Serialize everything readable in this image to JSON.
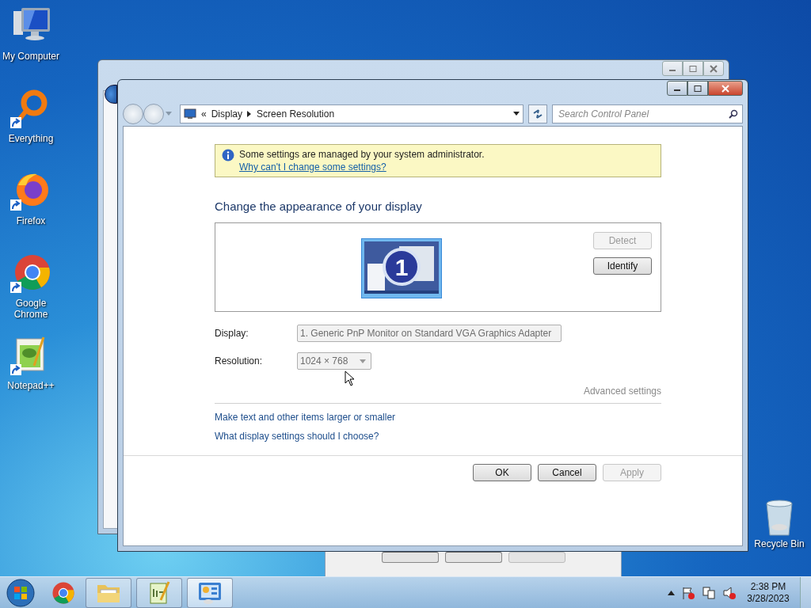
{
  "desktop_icons": [
    {
      "label": "My Computer",
      "kind": "computer",
      "shortcut": false
    },
    {
      "label": "Everything",
      "kind": "everything",
      "shortcut": true
    },
    {
      "label": "Firefox",
      "kind": "firefox",
      "shortcut": true
    },
    {
      "label": "Google Chrome",
      "kind": "chrome",
      "shortcut": true
    },
    {
      "label": "Notepad++",
      "kind": "notepad",
      "shortcut": true
    }
  ],
  "recycle_bin": {
    "label": "Recycle Bin"
  },
  "window": {
    "address": {
      "overflow_mark": "«",
      "path": [
        "Display",
        "Screen Resolution"
      ]
    },
    "search": {
      "placeholder": "Search Control Panel"
    },
    "notice": {
      "text": "Some settings are managed by your system administrator.",
      "link": "Why can't I change some settings?"
    },
    "heading": "Change the appearance of your display",
    "monitor_number": "1",
    "side_buttons": [
      {
        "label": "Detect",
        "disabled": true
      },
      {
        "label": "Identify",
        "disabled": false
      }
    ],
    "fields": [
      {
        "label": "Display:",
        "value": "1. Generic PnP Monitor on Standard VGA Graphics Adapter",
        "disabled": true
      },
      {
        "label": "Resolution:",
        "value": "1024 × 768",
        "disabled": true
      }
    ],
    "advanced_link": {
      "text": "Advanced settings",
      "disabled": true
    },
    "links": [
      "Make text and other items larger or smaller",
      "What display settings should I choose?"
    ],
    "dialog_buttons": [
      {
        "label": "OK",
        "disabled": false
      },
      {
        "label": "Cancel",
        "disabled": false
      },
      {
        "label": "Apply",
        "disabled": true
      }
    ]
  },
  "taskbar": {
    "items": [
      {
        "kind": "chrome",
        "active": false,
        "framed": false
      },
      {
        "kind": "explorer",
        "active": false,
        "framed": true
      },
      {
        "kind": "notepad",
        "active": false,
        "framed": true
      },
      {
        "kind": "control-panel",
        "active": true,
        "framed": true
      }
    ],
    "clock": {
      "time": "2:38 PM",
      "date": "3/28/2023"
    }
  }
}
